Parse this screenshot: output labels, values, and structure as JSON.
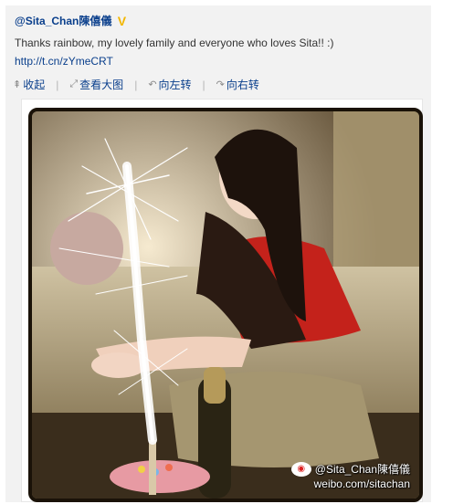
{
  "post": {
    "username": "@Sita_Chan陳僖儀",
    "verified_icon": "V",
    "text": "Thanks rainbow, my lovely family and everyone who loves Sita!! :)",
    "short_url": "http://t.cn/zYmeCRT"
  },
  "actions": [
    {
      "icon": "collapse-up-icon",
      "glyph": "⇞",
      "label": "收起"
    },
    {
      "icon": "view-large-icon",
      "glyph": "⤢",
      "label": "查看大图"
    },
    {
      "icon": "rotate-left-icon",
      "glyph": "↶",
      "label": "向左转"
    },
    {
      "icon": "rotate-right-icon",
      "glyph": "↷",
      "label": "向右转"
    }
  ],
  "watermark": {
    "handle": "@Sita_Chan陳僖儀",
    "site": "weibo.com/sitachan"
  },
  "colors": {
    "link": "#0a3f8c",
    "badge": "#f2b600",
    "dress": "#c4221b"
  }
}
